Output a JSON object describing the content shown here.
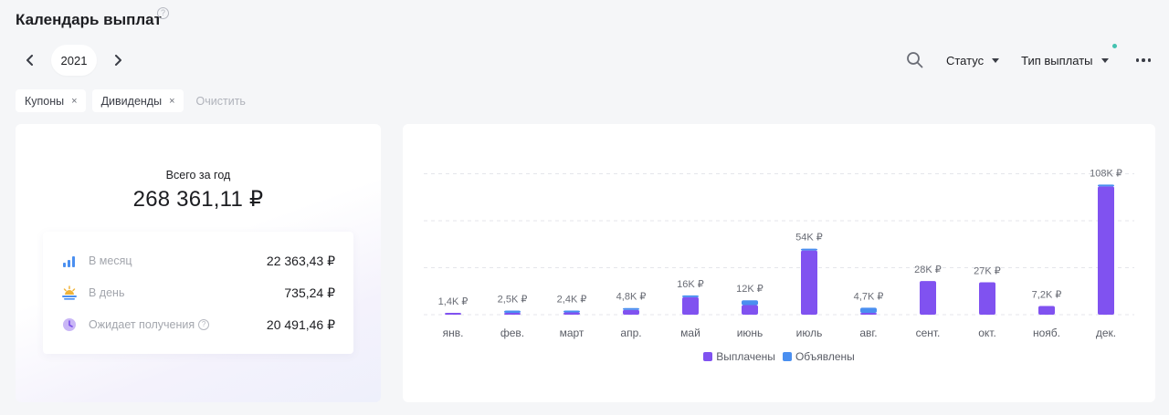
{
  "header": {
    "title": "Календарь выплат",
    "help": "?"
  },
  "year_nav": {
    "year": "2021"
  },
  "toolbar": {
    "status_label": "Статус",
    "payout_type_label": "Тип выплаты"
  },
  "filters": {
    "chips": [
      {
        "label": "Купоны"
      },
      {
        "label": "Дивиденды"
      }
    ],
    "chip_close": "×",
    "clear_label": "Очистить"
  },
  "summary": {
    "total_label": "Всего за год",
    "total_value": "268 361,11 ₽",
    "rows": [
      {
        "label": "В месяц",
        "value": "22 363,43 ₽",
        "icon": "bar-chart-icon"
      },
      {
        "label": "В день",
        "value": "735,24 ₽",
        "icon": "sunrise-icon"
      },
      {
        "label": "Ожидает получения",
        "value": "20 491,46 ₽",
        "icon": "clock-icon",
        "help": "?"
      }
    ]
  },
  "colors": {
    "paid": "#8052f0",
    "announced": "#4a8ff0",
    "accent_dot": "#44c2b0"
  },
  "chart_data": {
    "type": "bar",
    "stacked": true,
    "grid": true,
    "categories": [
      "янв.",
      "фев.",
      "март",
      "апр.",
      "май",
      "июнь",
      "июль",
      "авг.",
      "сент.",
      "окт.",
      "нояб.",
      "дек."
    ],
    "data_labels": [
      "1,4K ₽",
      "2,5K ₽",
      "2,4K ₽",
      "4,8K ₽",
      "16K ₽",
      "12K ₽",
      "54K ₽",
      "4,7K ₽",
      "28K ₽",
      "27K ₽",
      "7,2K ₽",
      "108K ₽"
    ],
    "series": [
      {
        "name": "Выплачены",
        "values": [
          1.4,
          0.6,
          1.9,
          4.0,
          14.5,
          8.0,
          53.5,
          0.4,
          28.0,
          27.0,
          7.2,
          107.0
        ]
      },
      {
        "name": "Объявлены",
        "values": [
          0,
          1.9,
          0.5,
          0.8,
          1.5,
          4.0,
          0.5,
          4.3,
          0,
          0,
          0,
          1.0
        ]
      }
    ],
    "ylim": [
      0,
      120
    ],
    "legend_position": "bottom"
  }
}
